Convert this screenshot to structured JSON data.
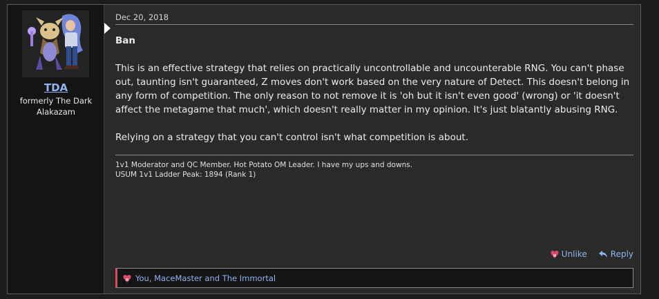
{
  "post": {
    "author": {
      "username": "TDA",
      "user_title": "formerly The Dark Alakazam"
    },
    "date": "Dec 20, 2018",
    "vote": "Ban",
    "paragraphs": [
      "This is an effective strategy that relies on practically uncontrollable and uncounterable RNG. You can't phase out, taunting isn't guaranteed, Z moves don't work based on the very nature of Detect. This doesn't belong in any form of competition. The only reason to not remove it is 'oh but it isn't even good' (wrong) or 'it doesn't affect the metagame that much', which doesn't really matter in my opinion. It's just blatantly abusing RNG.",
      "Relying on a strategy that you can't control isn't what competition is about."
    ],
    "signature": {
      "line1": "1v1 Moderator and QC Member. Hot Potato OM Leader. I have my ups and downs.",
      "line2": "USUM 1v1 Ladder Peak: 1894 (Rank 1)"
    },
    "actions": {
      "unlike_label": "Unlike",
      "reply_label": "Reply"
    },
    "likes_text": "You, MaceMaster and The Immortal"
  },
  "colors": {
    "link": "#8fb4f0",
    "like_accent": "#d94a6a",
    "panel_bg": "#2a2a2a",
    "sidebar_bg": "#141414"
  }
}
